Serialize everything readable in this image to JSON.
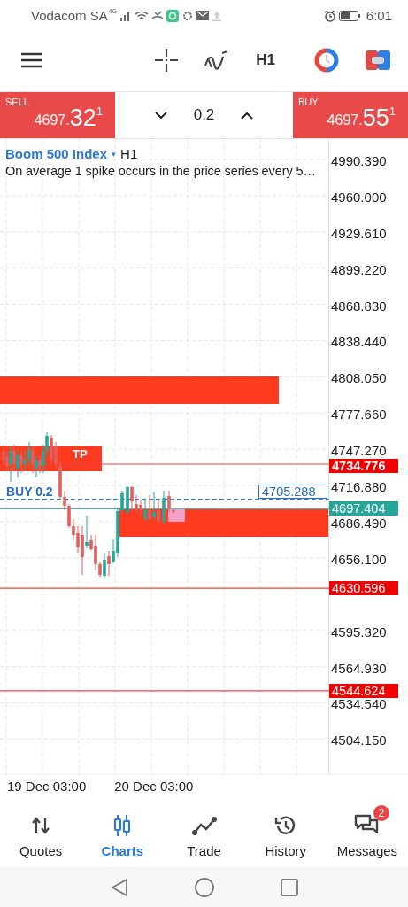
{
  "status_bar": {
    "carrier": "Vodacom SA",
    "network": "4G",
    "time": "6:01"
  },
  "toolbar": {
    "timeframe": "H1"
  },
  "trade_panel": {
    "sell": {
      "label": "SELL",
      "price_main": "4697.",
      "price_big": "32",
      "price_sup": "1"
    },
    "volume": "0.2",
    "buy": {
      "label": "BUY",
      "price_main": "4697.",
      "price_big": "55",
      "price_sup": "1"
    }
  },
  "chart": {
    "symbol": "Boom 500 Index",
    "dropdown": "▾",
    "timeframe": "H1",
    "description": "On average 1 spike occurs in the price series every 5…",
    "tp_label": "TP",
    "position_label": "BUY 0.2",
    "price_axis": [
      "4990.390",
      "4960.000",
      "4929.610",
      "4899.220",
      "4868.830",
      "4838.440",
      "4808.050",
      "4777.660",
      "4747.270",
      "4716.880",
      "4686.490",
      "4656.100",
      "4595.320",
      "4564.930",
      "4534.540",
      "4504.150"
    ],
    "price_markers": [
      {
        "price": "4734.776",
        "kind": "tp"
      },
      {
        "price": "4705.288",
        "kind": "entry"
      },
      {
        "price": "4697.404",
        "kind": "bid"
      },
      {
        "price": "4630.596",
        "kind": "level"
      },
      {
        "price": "4544.624",
        "kind": "level"
      }
    ],
    "time_axis": [
      "19 Dec 03:00",
      "20 Dec 03:00"
    ]
  },
  "bottom_nav": [
    {
      "label": "Quotes",
      "selected": false
    },
    {
      "label": "Charts",
      "selected": true
    },
    {
      "label": "Trade",
      "selected": false
    },
    {
      "label": "History",
      "selected": false
    },
    {
      "label": "Messages",
      "selected": false,
      "badge": "2"
    }
  ]
}
